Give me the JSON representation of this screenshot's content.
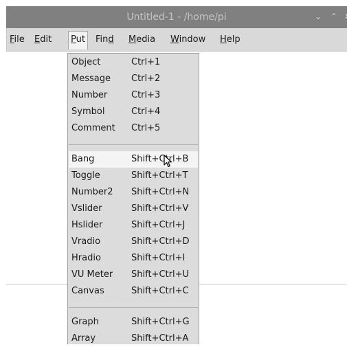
{
  "window": {
    "title": "Untitled-1  - /home/pi",
    "minimize_icon": "chevron-down-icon",
    "maximize_icon": "chevron-up-icon",
    "close_icon": "close-icon"
  },
  "menubar": [
    {
      "label": "File",
      "underline": "F",
      "rest": "ile"
    },
    {
      "label": "Edit",
      "underline": "E",
      "rest": "dit"
    },
    {
      "label": "Put",
      "underline": "P",
      "rest": "ut"
    },
    {
      "pre": "Fin",
      "underline": "d",
      "rest": ""
    },
    {
      "label": "Media",
      "underline": "M",
      "rest": "edia"
    },
    {
      "label": "Window",
      "underline": "W",
      "rest": "indow"
    },
    {
      "label": "Help",
      "underline": "H",
      "rest": "elp"
    }
  ],
  "put_menu": {
    "group1": [
      {
        "label": "Object",
        "shortcut": "Ctrl+1"
      },
      {
        "label": "Message",
        "shortcut": "Ctrl+2"
      },
      {
        "label": "Number",
        "shortcut": "Ctrl+3"
      },
      {
        "label": "Symbol",
        "shortcut": "Ctrl+4"
      },
      {
        "label": "Comment",
        "shortcut": "Ctrl+5"
      }
    ],
    "group2": [
      {
        "label": "Bang",
        "shortcut": "Shift+Ctrl+B"
      },
      {
        "label": "Toggle",
        "shortcut": "Shift+Ctrl+T"
      },
      {
        "label": "Number2",
        "shortcut": "Shift+Ctrl+N"
      },
      {
        "label": "Vslider",
        "shortcut": "Shift+Ctrl+V"
      },
      {
        "label": "Hslider",
        "shortcut": "Shift+Ctrl+J"
      },
      {
        "label": "Vradio",
        "shortcut": "Shift+Ctrl+D"
      },
      {
        "label": "Hradio",
        "shortcut": "Shift+Ctrl+I"
      },
      {
        "label": "VU Meter",
        "shortcut": "Shift+Ctrl+U"
      },
      {
        "label": "Canvas",
        "shortcut": "Shift+Ctrl+C"
      }
    ],
    "group3": [
      {
        "label": "Graph",
        "shortcut": "Shift+Ctrl+G"
      },
      {
        "label": "Array",
        "shortcut": "Shift+Ctrl+A"
      }
    ],
    "highlighted": "Bang"
  }
}
